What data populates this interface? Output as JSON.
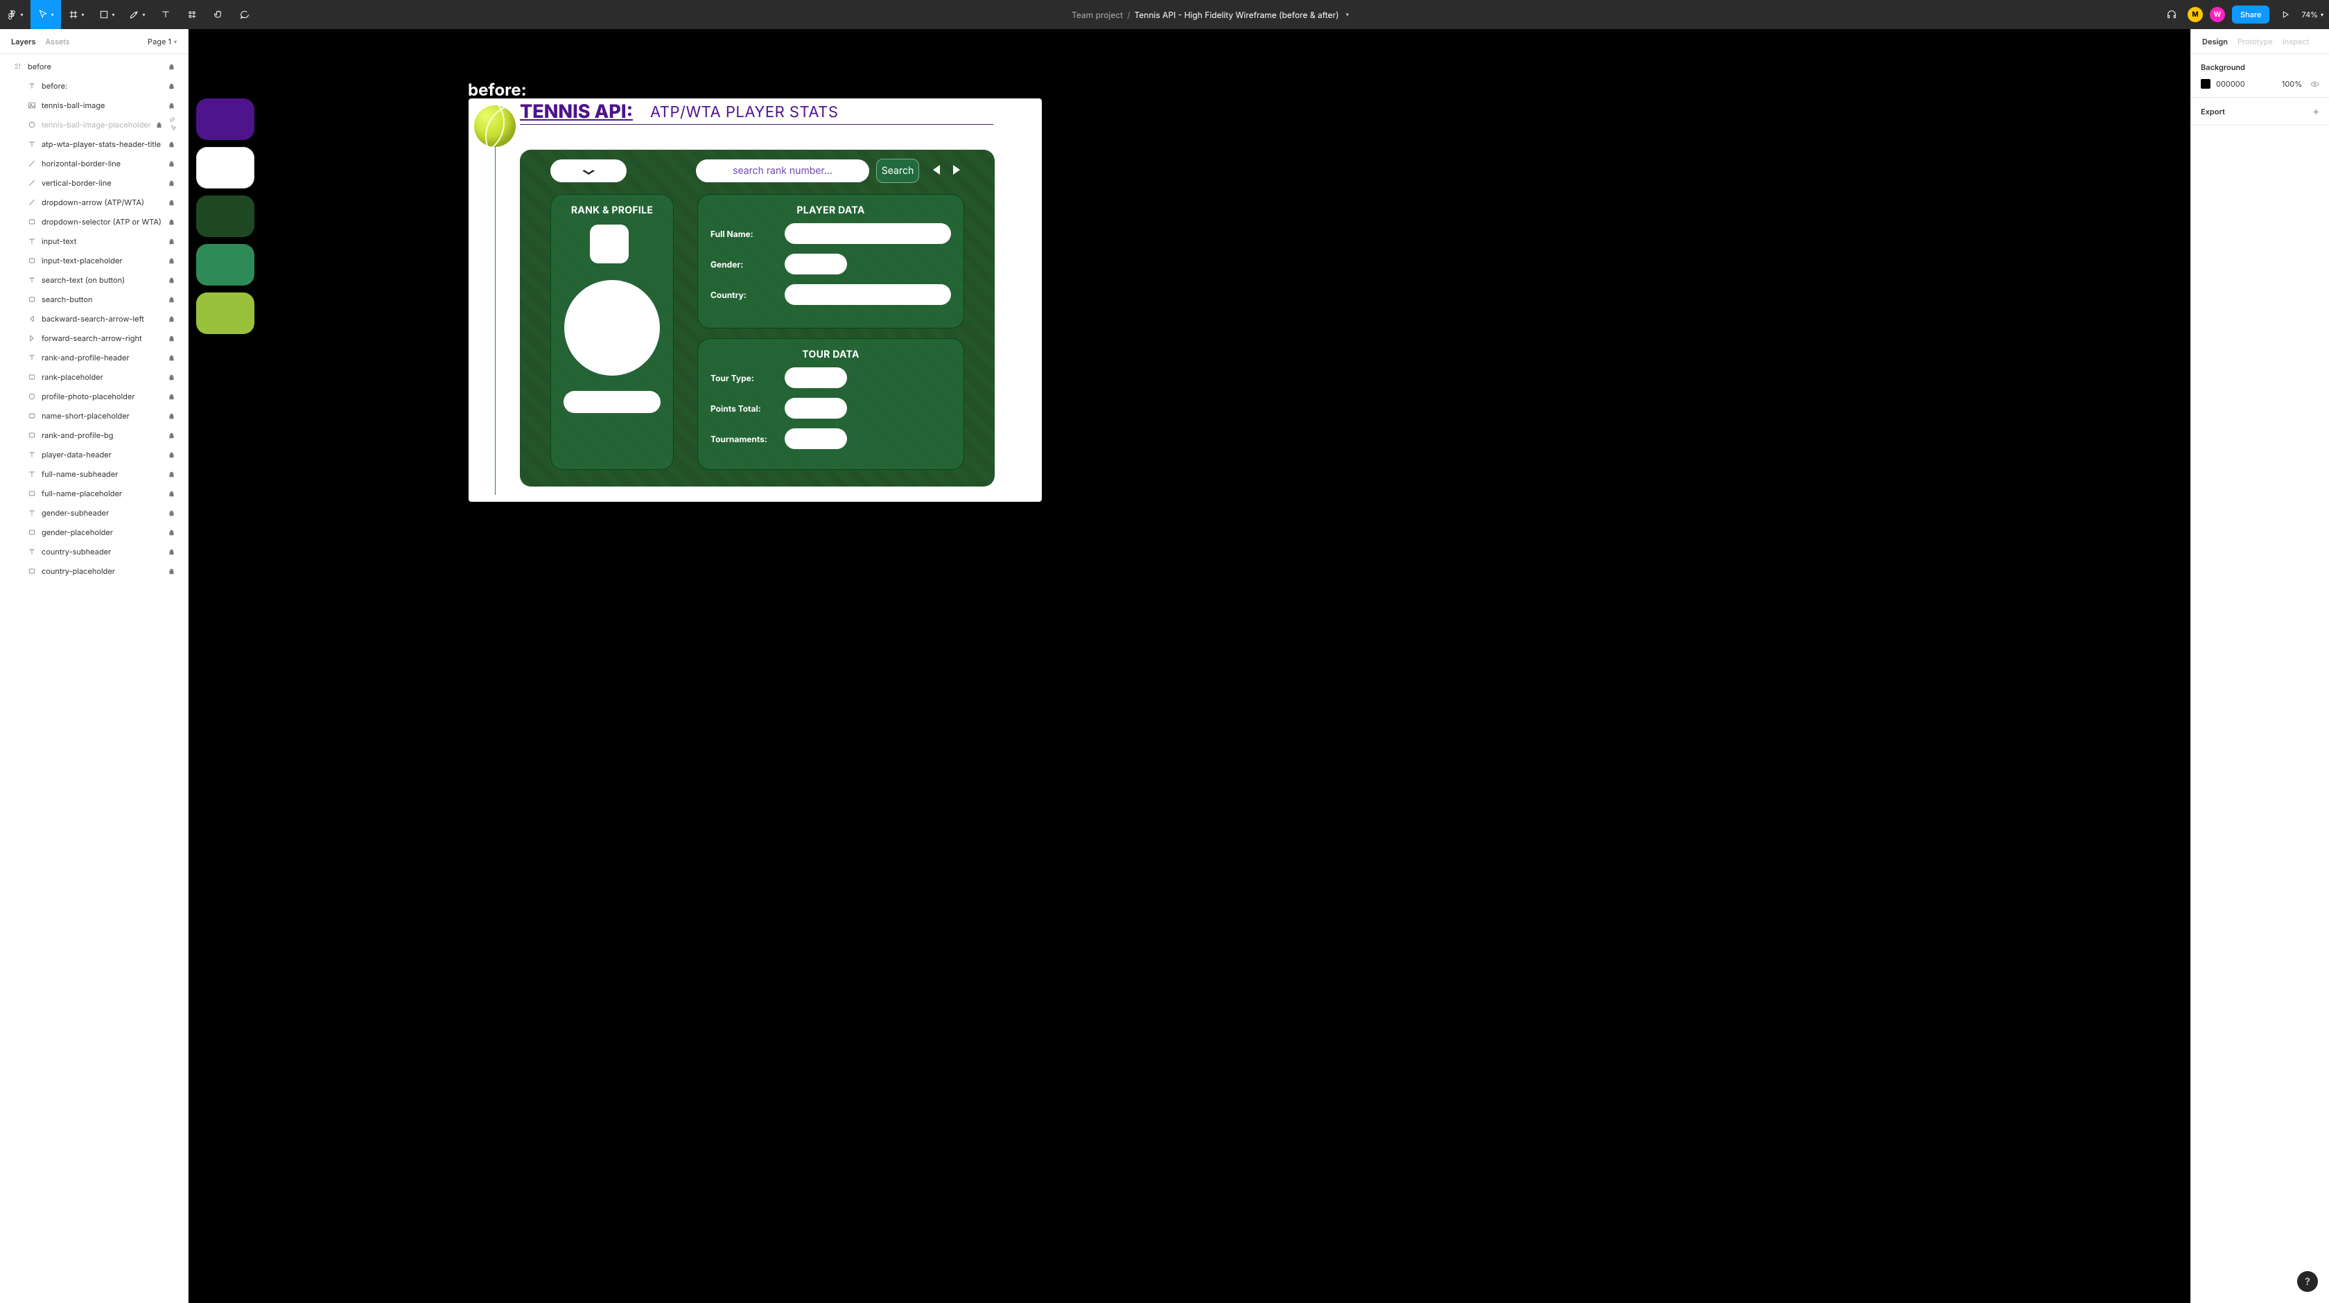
{
  "topbar": {
    "team": "Team project",
    "doc": "Tennis API - High Fidelity Wireframe (before & after)",
    "share": "Share",
    "zoom": "74%",
    "avatars": [
      "M",
      "W"
    ]
  },
  "left": {
    "tabs": [
      "Layers",
      "Assets"
    ],
    "page": "Page 1",
    "root": "before",
    "layers": [
      {
        "type": "text",
        "name": "before:"
      },
      {
        "type": "image",
        "name": "tennis-ball-image"
      },
      {
        "type": "ellipse",
        "name": "tennis-ball-image-placeholder",
        "dim": true,
        "extra": "link-select"
      },
      {
        "type": "text",
        "name": "atp-wta-player-stats-header-title"
      },
      {
        "type": "line",
        "name": "horizontal-border-line"
      },
      {
        "type": "line",
        "name": "vertical-border-line"
      },
      {
        "type": "line",
        "name": "dropdown-arrow (ATP/WTA)"
      },
      {
        "type": "rect",
        "name": "dropdown-selector (ATP or WTA)"
      },
      {
        "type": "text",
        "name": "input-text"
      },
      {
        "type": "rect",
        "name": "input-text-placeholder"
      },
      {
        "type": "text",
        "name": "search-text (on button)"
      },
      {
        "type": "rect",
        "name": "search-button"
      },
      {
        "type": "tri-l",
        "name": "backward-search-arrow-left"
      },
      {
        "type": "tri-r",
        "name": "forward-search-arrow-right"
      },
      {
        "type": "text",
        "name": "rank-and-profile-header"
      },
      {
        "type": "rect",
        "name": "rank-placeholder"
      },
      {
        "type": "ellipse",
        "name": "profile-photo-placeholder"
      },
      {
        "type": "rect",
        "name": "name-short-placeholder"
      },
      {
        "type": "rect",
        "name": "rank-and-profile-bg"
      },
      {
        "type": "text",
        "name": "player-data-header"
      },
      {
        "type": "text",
        "name": "full-name-subheader"
      },
      {
        "type": "rect",
        "name": "full-name-placeholder"
      },
      {
        "type": "text",
        "name": "gender-subheader"
      },
      {
        "type": "rect",
        "name": "gender-placeholder"
      },
      {
        "type": "text",
        "name": "country-subheader"
      },
      {
        "type": "rect",
        "name": "country-placeholder"
      }
    ]
  },
  "right": {
    "tabs": [
      "Design",
      "Prototype",
      "Inspect"
    ],
    "bg_title": "Background",
    "bg_hex": "000000",
    "bg_pct": "100%",
    "export_title": "Export"
  },
  "design": {
    "before_label": "before:",
    "title_main": "TENNIS API:",
    "title_sub": "ATP/WTA PLAYER STATS",
    "search_placeholder": "search rank number...",
    "search_button": "Search",
    "rank_profile_title": "RANK & PROFILE",
    "player_data_title": "PLAYER DATA",
    "player_fields": [
      "Full Name:",
      "Gender:",
      "Country:"
    ],
    "tour_data_title": "TOUR DATA",
    "tour_fields": [
      "Tour Type:",
      "Points Total:",
      "Tournaments:"
    ],
    "swatches": [
      "#4d148c",
      "#ffffff",
      "#1e4822",
      "#2e8b57",
      "#99c13b"
    ]
  }
}
